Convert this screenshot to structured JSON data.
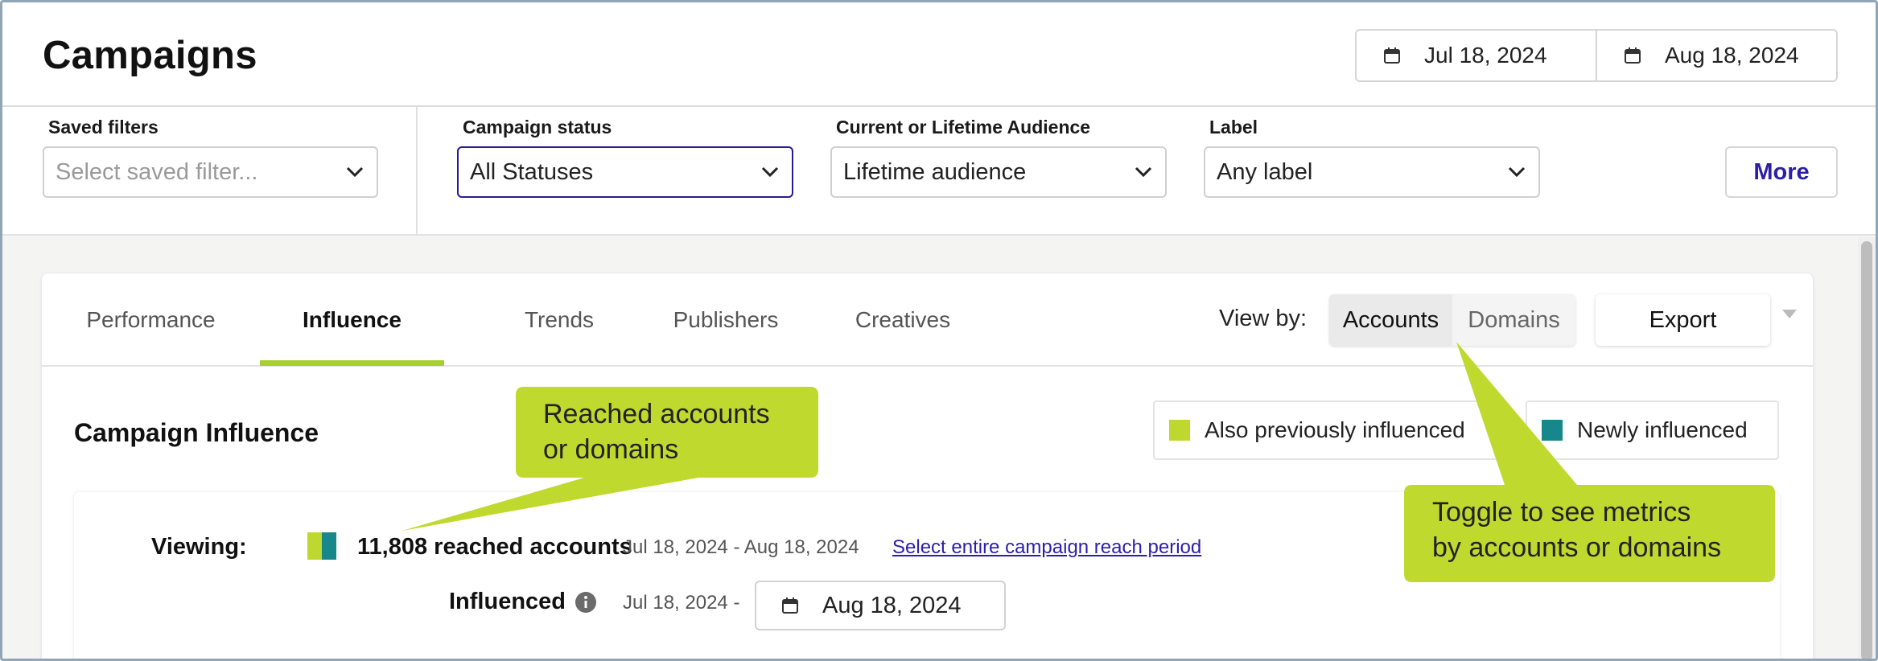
{
  "header": {
    "title": "Campaigns",
    "date_start": "Jul 18, 2024",
    "date_end": "Aug 18, 2024"
  },
  "filters": {
    "saved_filters": {
      "label": "Saved filters",
      "placeholder": "Select saved filter..."
    },
    "campaign_status": {
      "label": "Campaign status",
      "value": "All Statuses"
    },
    "audience": {
      "label": "Current or Lifetime Audience",
      "value": "Lifetime audience"
    },
    "label_filter": {
      "label": "Label",
      "value": "Any label"
    },
    "more_label": "More"
  },
  "tabs": [
    {
      "label": "Performance"
    },
    {
      "label": "Influence"
    },
    {
      "label": "Trends"
    },
    {
      "label": "Publishers"
    },
    {
      "label": "Creatives"
    }
  ],
  "active_tab": "Influence",
  "view_by": {
    "label": "View by:",
    "options": [
      "Accounts",
      "Domains"
    ],
    "selected": "Accounts"
  },
  "export_label": "Export",
  "influence": {
    "title": "Campaign Influence",
    "legend": [
      {
        "label": "Also previously influenced",
        "color": "#bed82f"
      },
      {
        "label": "Newly influenced",
        "color": "#16878a"
      }
    ],
    "viewing_label": "Viewing:",
    "reached_count": "11,808 reached accounts",
    "period": "Jul 18, 2024 - Aug 18, 2024",
    "period_link": "Select entire campaign reach period",
    "influenced_label": "Influenced",
    "influenced_start": "Jul 18, 2024 -",
    "influenced_end": "Aug 18, 2024"
  },
  "callouts": {
    "reached": {
      "line1": "Reached accounts",
      "line2": "or domains"
    },
    "toggle": {
      "line1": "Toggle to see metrics",
      "line2": "by accounts or domains"
    },
    "color": "#bfd92f"
  },
  "icons": {
    "calendar": "calendar-icon",
    "chevron": "chevron-down-icon",
    "info": "info-icon"
  }
}
